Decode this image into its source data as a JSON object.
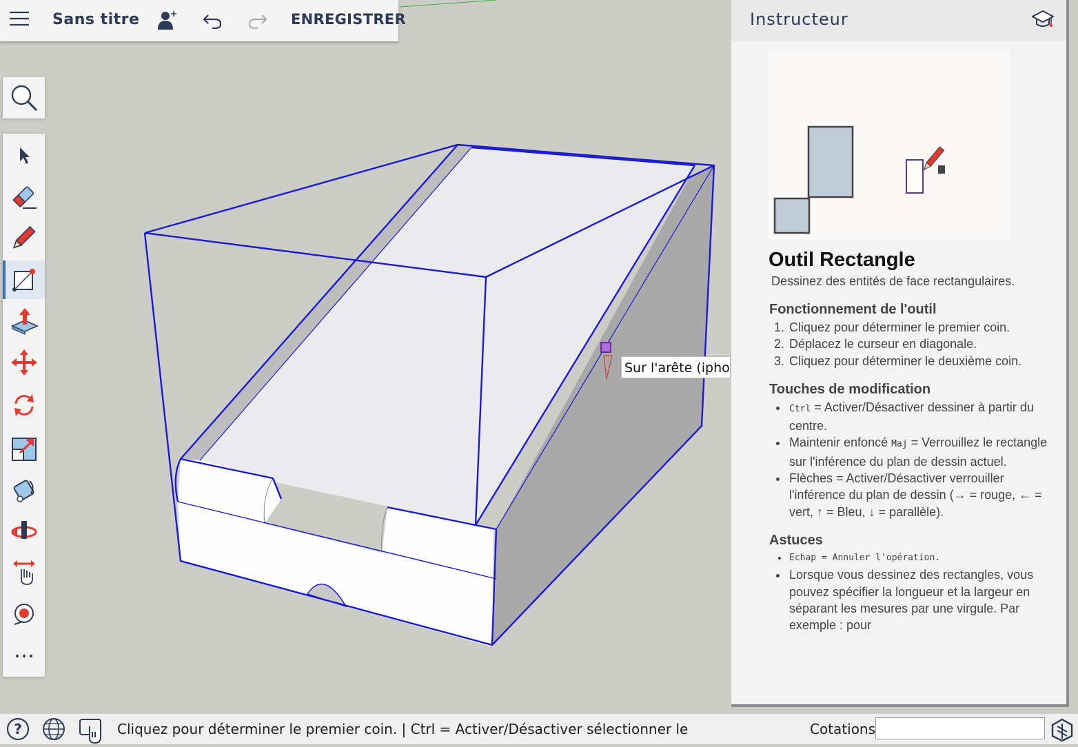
{
  "topbar": {
    "title": "Sans titre",
    "save_label": "ENREGISTRER",
    "icons": [
      "menu-icon",
      "add-user-icon",
      "undo-icon",
      "redo-icon"
    ]
  },
  "toolbar": {
    "search_tool": "magnifier-icon",
    "tools": [
      {
        "name": "select",
        "icon": "arrow-cursor-icon"
      },
      {
        "name": "eraser",
        "icon": "eraser-icon"
      },
      {
        "name": "line",
        "icon": "pencil-icon"
      },
      {
        "name": "rectangle",
        "icon": "rectangle-icon",
        "active": true
      },
      {
        "name": "push-pull",
        "icon": "push-pull-icon"
      },
      {
        "name": "move",
        "icon": "move-icon"
      },
      {
        "name": "rotate",
        "icon": "rotate-icon"
      },
      {
        "name": "scale",
        "icon": "scale-icon"
      },
      {
        "name": "paint",
        "icon": "paint-bucket-icon"
      },
      {
        "name": "orbit",
        "icon": "orbit-icon"
      },
      {
        "name": "pan",
        "icon": "pan-hand-icon"
      },
      {
        "name": "zoom-extents",
        "icon": "position-camera-icon"
      },
      {
        "name": "more",
        "icon": "more-icon"
      }
    ]
  },
  "viewport": {
    "tooltip": "Sur l'arête (iphone)"
  },
  "instructor": {
    "header": "Instructeur",
    "tool_name": "Outil Rectangle",
    "tool_desc": "Dessinez des entités de face rectangulaires.",
    "section_operation": "Fonctionnement de l'outil",
    "steps": [
      "Cliquez pour déterminer le premier coin.",
      "Déplacez le curseur en diagonale.",
      "Cliquez pour déterminer le deuxième coin."
    ],
    "section_modifiers": "Touches de modification",
    "modifiers": [
      {
        "key": "Ctrl",
        "text": " = Activer/Désactiver dessiner à partir du centre."
      },
      {
        "prefix": "Maintenir enfoncé ",
        "key": "Maj",
        "text": " = Verrouillez le rectangle sur l'inférence du plan de dessin actuel."
      },
      {
        "text": "Flèches = Activer/Désactiver verrouiller l'inférence du plan de dessin (→ = rouge, ← = vert, ↑ = Bleu, ↓ = parallèle)."
      }
    ],
    "section_tips": "Astuces",
    "tips": [
      "Echap = Annuler l'opération.",
      "Lorsque vous dessinez des rectangles, vous pouvez spécifier la longueur et la largeur en séparant les mesures par une virgule. Par exemple : pour"
    ]
  },
  "statusbar": {
    "message": "Cliquez pour déterminer le premier coin. | Ctrl = Activer/Désactiver sélectionner le",
    "dimensions_label": "Cotations",
    "dimensions_value": "",
    "icons": [
      "help-icon",
      "globe-icon",
      "touch-icon",
      "sketchup-logo-icon"
    ]
  },
  "colors": {
    "accent": "#2d3b57",
    "selection": "#1a1ad6",
    "active_tool": "#3b6fb6"
  }
}
